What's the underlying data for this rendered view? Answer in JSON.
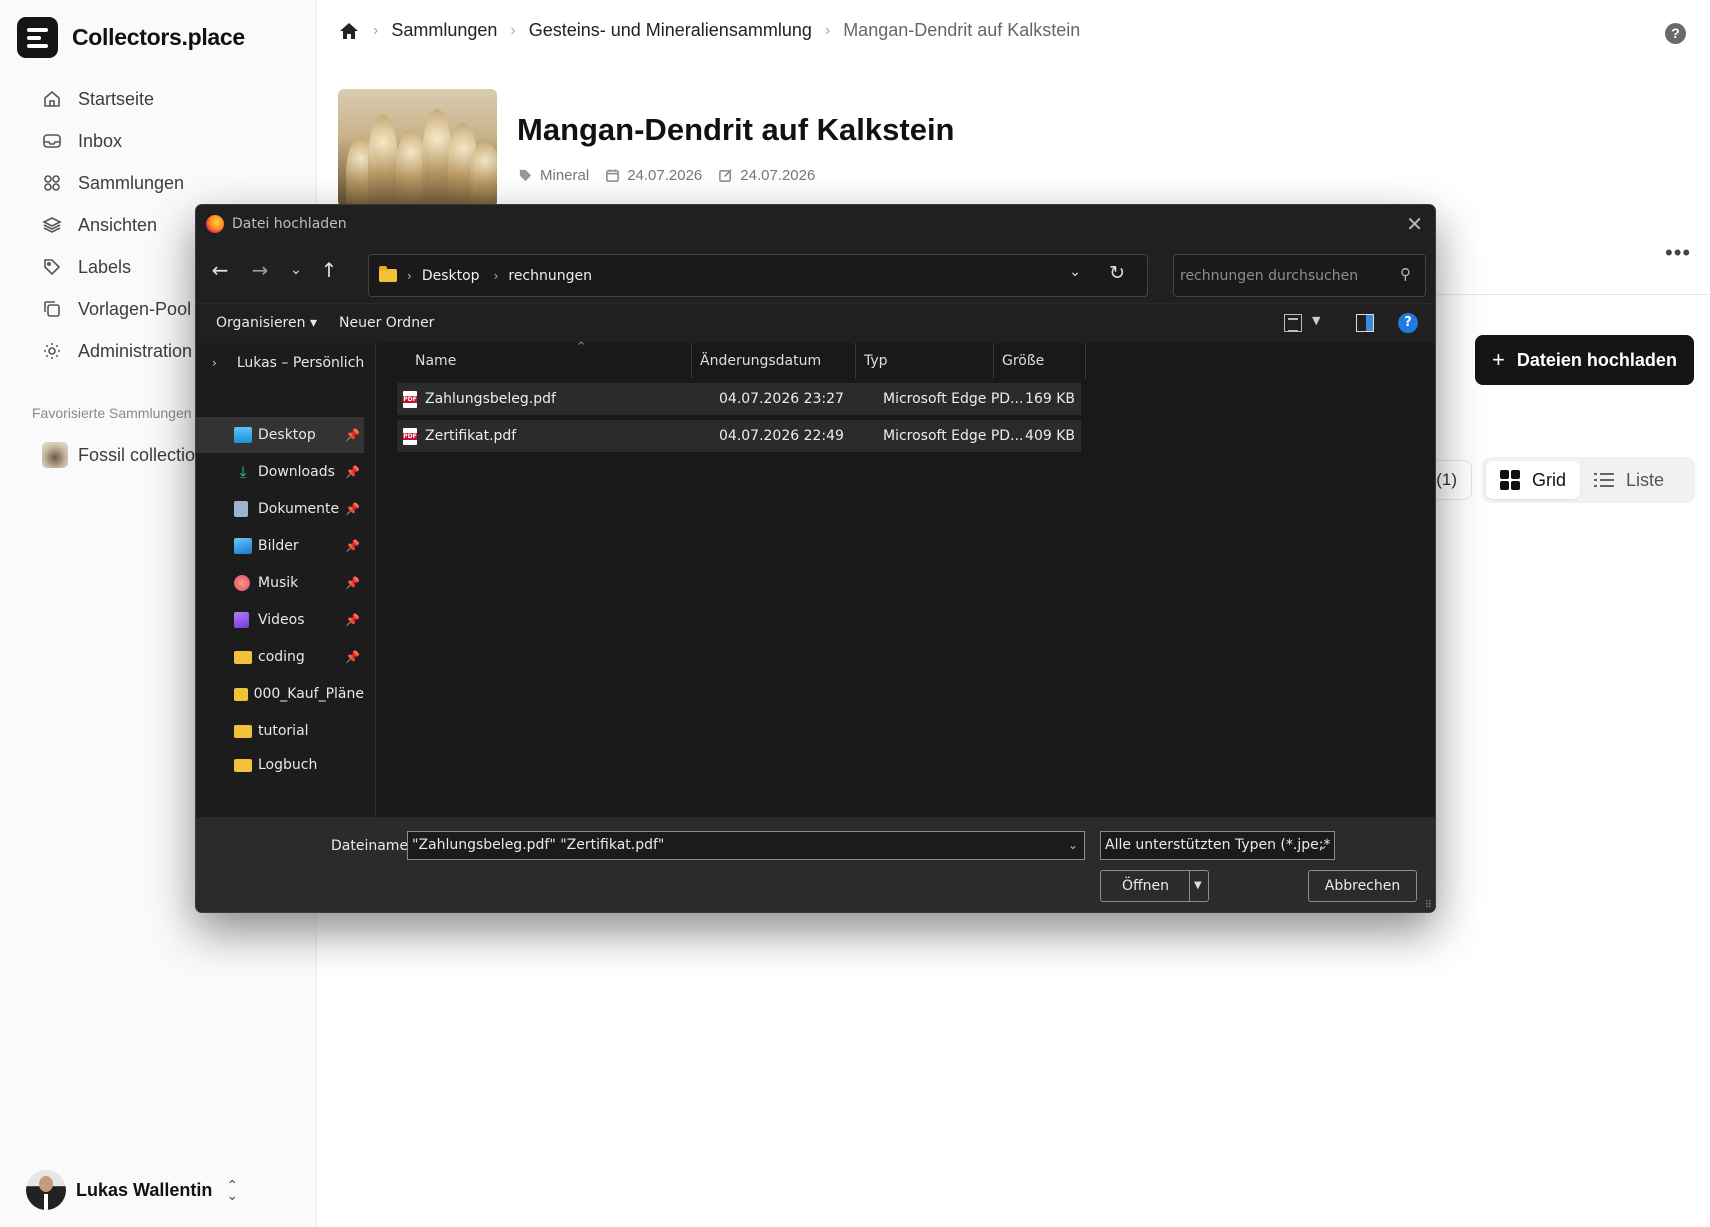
{
  "app": {
    "name": "Collectors.place"
  },
  "sidebar": {
    "items": [
      {
        "label": "Startseite",
        "icon": "home-icon"
      },
      {
        "label": "Inbox",
        "icon": "inbox-icon"
      },
      {
        "label": "Sammlungen",
        "icon": "grid-icon"
      },
      {
        "label": "Ansichten",
        "icon": "layers-icon"
      },
      {
        "label": "Labels",
        "icon": "tag-icon"
      },
      {
        "label": "Vorlagen-Pool",
        "icon": "copy-icon"
      },
      {
        "label": "Administration",
        "icon": "gear-icon"
      }
    ],
    "favorites_title": "Favorisierte Sammlungen",
    "favorites": [
      {
        "label": "Fossil collection"
      }
    ],
    "user": {
      "name": "Lukas Wallentin"
    }
  },
  "breadcrumb": {
    "items": [
      "Sammlungen",
      "Gesteins- und Mineraliensammlung"
    ],
    "current": "Mangan-Dendrit auf Kalkstein"
  },
  "item": {
    "title": "Mangan-Dendrit auf Kalkstein",
    "label": "Mineral",
    "created": "24.07.2026",
    "modified": "24.07.2026"
  },
  "actions": {
    "upload_label": "Dateien hochladen"
  },
  "files_count": "(1)",
  "view_toggle": {
    "grid": "Grid",
    "list": "Liste",
    "active": "grid"
  },
  "dialog": {
    "title": "Datei hochladen",
    "path": [
      "Desktop",
      "rechnungen"
    ],
    "search_placeholder": "rechnungen durchsuchen",
    "commands": {
      "organize": "Organisieren",
      "new_folder": "Neuer Ordner"
    },
    "nav_pane": [
      {
        "label": "Lukas – Persönlich",
        "pinned": false,
        "expandable": true,
        "icon": "onedrive-icon"
      },
      {
        "label": "Desktop",
        "pinned": true,
        "selected": true,
        "icon": "desktop-icon"
      },
      {
        "label": "Downloads",
        "pinned": true,
        "icon": "download-icon"
      },
      {
        "label": "Dokumente",
        "pinned": true,
        "icon": "document-icon"
      },
      {
        "label": "Bilder",
        "pinned": true,
        "icon": "pictures-icon"
      },
      {
        "label": "Musik",
        "pinned": true,
        "icon": "music-icon"
      },
      {
        "label": "Videos",
        "pinned": true,
        "icon": "video-icon"
      },
      {
        "label": "coding",
        "pinned": true,
        "icon": "folder-icon"
      },
      {
        "label": "000_Kauf_Pläne",
        "pinned": false,
        "icon": "folder-icon"
      },
      {
        "label": "tutorial",
        "pinned": false,
        "icon": "folder-icon"
      },
      {
        "label": "Logbuch",
        "pinned": false,
        "icon": "folder-icon"
      }
    ],
    "columns": [
      "Name",
      "Änderungsdatum",
      "Typ",
      "Größe"
    ],
    "files": [
      {
        "name": "Zahlungsbeleg.pdf",
        "modified": "04.07.2026 23:27",
        "type": "Microsoft Edge PD...",
        "size": "169 KB"
      },
      {
        "name": "Zertifikat.pdf",
        "modified": "04.07.2026 22:49",
        "type": "Microsoft Edge PD...",
        "size": "409 KB"
      }
    ],
    "filename_label": "Dateiname:",
    "filename_value": "\"Zahlungsbeleg.pdf\" \"Zertifikat.pdf\"",
    "filetype": "Alle unterstützten Typen (*.jpe;*",
    "open_label": "Öffnen",
    "cancel_label": "Abbrechen"
  }
}
